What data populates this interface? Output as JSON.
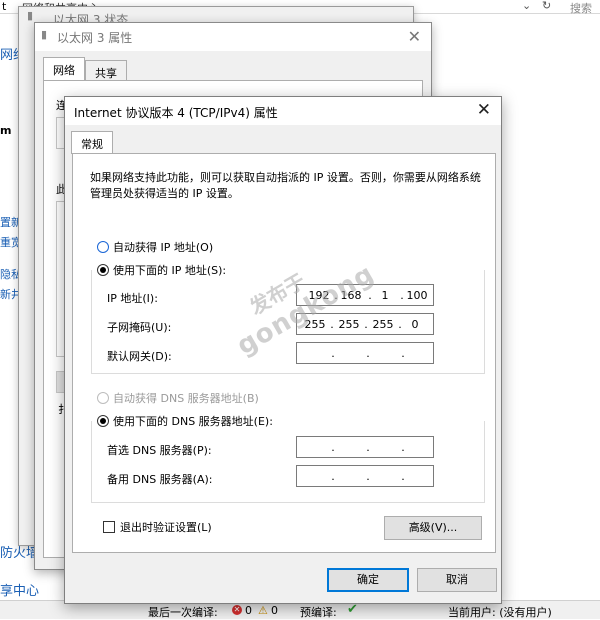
{
  "background": {
    "path_start": "t",
    "path_crumb": "网络和共享中心",
    "search_placeholder": "搜索",
    "left_items": [
      "网络",
      "m",
      "置新",
      "重宽",
      "隐私",
      "新井",
      "防火墙",
      "享中心"
    ],
    "status_bar": {
      "last_compile_label": "最后一次编译:",
      "errors": "0",
      "warnings": "0",
      "precompile_label": "预编译:",
      "current_user": "当前用户: (没有用户)"
    }
  },
  "window_status": {
    "title": "以太网 3 状态"
  },
  "window_props": {
    "title": "以太网 3 属性",
    "tabs": [
      "网络",
      "共享"
    ],
    "connect_label": "连",
    "this_label": "此",
    "items_label": "扌"
  },
  "dialog": {
    "title": "Internet 协议版本 4 (TCP/IPv4) 属性",
    "close_glyph": "✕",
    "tab": "常规",
    "description": "如果网络支持此功能，则可以获取自动指派的 IP 设置。否则，你需要从网络系统管理员处获得适当的 IP 设置。",
    "auto_ip": "自动获得 IP 地址(O)",
    "manual_ip": "使用下面的 IP 地址(S):",
    "ip_label": "IP 地址(I):",
    "ip": [
      "192",
      "168",
      "1",
      "100"
    ],
    "mask_label": "子网掩码(U):",
    "mask": [
      "255",
      "255",
      "255",
      "0"
    ],
    "gateway_label": "默认网关(D):",
    "gateway": [
      "",
      "",
      "",
      ""
    ],
    "auto_dns": "自动获得 DNS 服务器地址(B)",
    "manual_dns": "使用下面的 DNS 服务器地址(E):",
    "dns1_label": "首选 DNS 服务器(P):",
    "dns1": [
      "",
      "",
      "",
      ""
    ],
    "dns2_label": "备用 DNS 服务器(A):",
    "dns2": [
      "",
      "",
      "",
      ""
    ],
    "validate_label": "退出时验证设置(L)",
    "advanced_button": "高级(V)...",
    "ok_button": "确定",
    "cancel_button": "取消"
  },
  "watermark": {
    "line1": "发布于",
    "line2": "gongkong"
  },
  "colors": {
    "accent": "#0078d7",
    "link": "#1a5fb4",
    "dialog_bg": "#f0f0f0"
  }
}
